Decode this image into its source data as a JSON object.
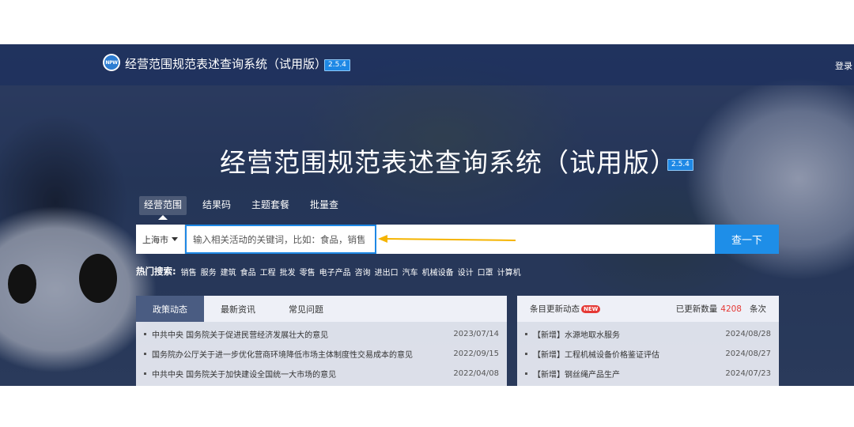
{
  "header": {
    "logo_text": "NPW",
    "title": "经营范围规范表述查询系统（试用版）",
    "version": "2.5.4",
    "login": "登录"
  },
  "hero": {
    "title": "经营范围规范表述查询系统（试用版）",
    "version": "2.5.4"
  },
  "search": {
    "tabs": [
      "经营范围",
      "结果码",
      "主题套餐",
      "批量查"
    ],
    "active_tab": "经营范围",
    "city": "上海市",
    "placeholder": "输入相关活动的关键词，比如：食品，销售",
    "button": "查一下",
    "annotation_color": "#f5b400"
  },
  "hot_search": {
    "label": "热门搜索:",
    "terms": [
      "销售",
      "服务",
      "建筑",
      "食品",
      "工程",
      "批发",
      "零售",
      "电子产品",
      "咨询",
      "进出口",
      "汽车",
      "机械设备",
      "设计",
      "口罩",
      "计算机"
    ]
  },
  "news_panel": {
    "tabs": [
      "政策动态",
      "最新资讯",
      "常见问题"
    ],
    "active_tab": "政策动态",
    "items": [
      {
        "title": "中共中央 国务院关于促进民营经济发展壮大的意见",
        "date": "2023/07/14"
      },
      {
        "title": "国务院办公厅关于进一步优化营商环境降低市场主体制度性交易成本的意见",
        "date": "2022/09/15"
      },
      {
        "title": "中共中央 国务院关于加快建设全国统一大市场的意见",
        "date": "2022/04/08"
      }
    ]
  },
  "updates_panel": {
    "title": "条目更新动态",
    "new_badge": "NEW",
    "count_label": "已更新数量",
    "count": "4208",
    "count_unit": "条次",
    "items": [
      {
        "tag": "【新增】",
        "title": "水源地取水服务",
        "date": "2024/08/28"
      },
      {
        "tag": "【新增】",
        "title": "工程机械设备价格鉴证评估",
        "date": "2024/08/27"
      },
      {
        "tag": "【新增】",
        "title": "钢丝绳产品生产",
        "date": "2024/07/23"
      }
    ]
  },
  "colors": {
    "accent": "#1e88e5",
    "highlight_number": "#e53935"
  }
}
